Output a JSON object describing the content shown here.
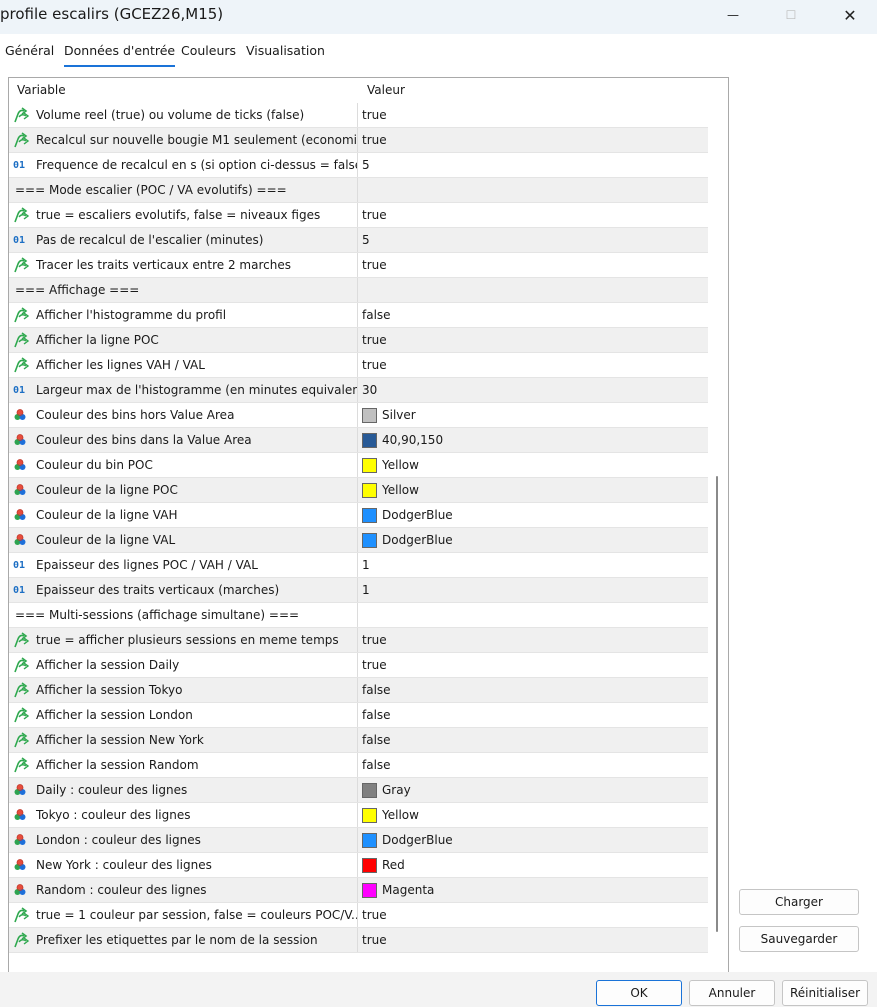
{
  "window": {
    "title": "profile escalirs (GCEZ26,M15)",
    "minimize_glyph": "—",
    "maximize_glyph": "☐",
    "close_glyph": "✕"
  },
  "tabs": [
    {
      "label": "Général"
    },
    {
      "label": "Données d'entrée",
      "active": true
    },
    {
      "label": "Couleurs"
    },
    {
      "label": "Visualisation"
    }
  ],
  "grid": {
    "header_variable": "Variable",
    "header_value": "Valeur",
    "rows": [
      {
        "icon": "bool-arrow-icon",
        "name": "Volume reel (true) ou volume de ticks (false)",
        "value": "true"
      },
      {
        "icon": "bool-arrow-icon",
        "name": "Recalcul sur nouvelle bougie M1 seulement (economi...",
        "value": "true"
      },
      {
        "icon": "number-icon",
        "name": "Frequence de recalcul en s (si option ci-dessus = false)",
        "value": "5"
      },
      {
        "icon": "none",
        "name": "=== Mode escalier (POC / VA evolutifs) ===",
        "value": ""
      },
      {
        "icon": "bool-arrow-icon",
        "name": "true = escaliers evolutifs, false = niveaux figes",
        "value": "true"
      },
      {
        "icon": "number-icon",
        "name": "Pas de recalcul de l'escalier (minutes)",
        "value": "5"
      },
      {
        "icon": "bool-arrow-icon",
        "name": "Tracer les traits verticaux entre 2 marches",
        "value": "true"
      },
      {
        "icon": "none",
        "name": "=== Affichage ===",
        "value": ""
      },
      {
        "icon": "bool-arrow-icon",
        "name": "Afficher l'histogramme du profil",
        "value": "false"
      },
      {
        "icon": "bool-arrow-icon",
        "name": "Afficher la ligne POC",
        "value": "true"
      },
      {
        "icon": "bool-arrow-icon",
        "name": "Afficher les lignes VAH / VAL",
        "value": "true"
      },
      {
        "icon": "number-icon",
        "name": "Largeur max de l'histogramme (en minutes equivalen...",
        "value": "30"
      },
      {
        "icon": "color-icon",
        "name": "Couleur des bins hors Value Area",
        "value": "Silver",
        "swatch": "#c0c0c0"
      },
      {
        "icon": "color-icon",
        "name": "Couleur des bins dans la Value Area",
        "value": "40,90,150",
        "swatch": "#285a96"
      },
      {
        "icon": "color-icon",
        "name": "Couleur du bin POC",
        "value": "Yellow",
        "swatch": "#ffff00"
      },
      {
        "icon": "color-icon",
        "name": "Couleur de la ligne POC",
        "value": "Yellow",
        "swatch": "#ffff00"
      },
      {
        "icon": "color-icon",
        "name": "Couleur de la ligne VAH",
        "value": "DodgerBlue",
        "swatch": "#1e90ff"
      },
      {
        "icon": "color-icon",
        "name": "Couleur de la ligne VAL",
        "value": "DodgerBlue",
        "swatch": "#1e90ff"
      },
      {
        "icon": "number-icon",
        "name": "Epaisseur des lignes POC / VAH / VAL",
        "value": "1"
      },
      {
        "icon": "number-icon",
        "name": "Epaisseur des traits verticaux (marches)",
        "value": "1"
      },
      {
        "icon": "none",
        "name": "=== Multi-sessions (affichage simultane) ===",
        "value": ""
      },
      {
        "icon": "bool-arrow-icon",
        "name": "true = afficher plusieurs sessions en meme temps",
        "value": "true"
      },
      {
        "icon": "bool-arrow-icon",
        "name": "Afficher la session Daily",
        "value": "true"
      },
      {
        "icon": "bool-arrow-icon",
        "name": "Afficher la session Tokyo",
        "value": "false"
      },
      {
        "icon": "bool-arrow-icon",
        "name": "Afficher la session London",
        "value": "false"
      },
      {
        "icon": "bool-arrow-icon",
        "name": "Afficher la session New York",
        "value": "false"
      },
      {
        "icon": "bool-arrow-icon",
        "name": "Afficher la session Random",
        "value": "false"
      },
      {
        "icon": "color-icon",
        "name": "Daily : couleur des lignes",
        "value": "Gray",
        "swatch": "#808080"
      },
      {
        "icon": "color-icon",
        "name": "Tokyo : couleur des lignes",
        "value": "Yellow",
        "swatch": "#ffff00"
      },
      {
        "icon": "color-icon",
        "name": "London : couleur des lignes",
        "value": "DodgerBlue",
        "swatch": "#1e90ff"
      },
      {
        "icon": "color-icon",
        "name": "New York : couleur des lignes",
        "value": "Red",
        "swatch": "#ff0000"
      },
      {
        "icon": "color-icon",
        "name": "Random : couleur des lignes",
        "value": "Magenta",
        "swatch": "#ff00ff"
      },
      {
        "icon": "bool-arrow-icon",
        "name": "true = 1 couleur par session, false = couleurs POC/V...",
        "value": "true"
      },
      {
        "icon": "bool-arrow-icon",
        "name": "Prefixer les etiquettes par le nom de la session",
        "value": "true"
      }
    ]
  },
  "side_buttons": {
    "charger": "Charger",
    "sauvegarder": "Sauvegarder"
  },
  "footer": {
    "ok": "OK",
    "annuler": "Annuler",
    "reinitialiser": "Réinitialiser"
  },
  "colors": {
    "accent": "#1a73d8",
    "bool_icon": "#2fa84f",
    "number_icon": "#1d6fc4"
  },
  "icons": {
    "number_icon_text": "01"
  }
}
